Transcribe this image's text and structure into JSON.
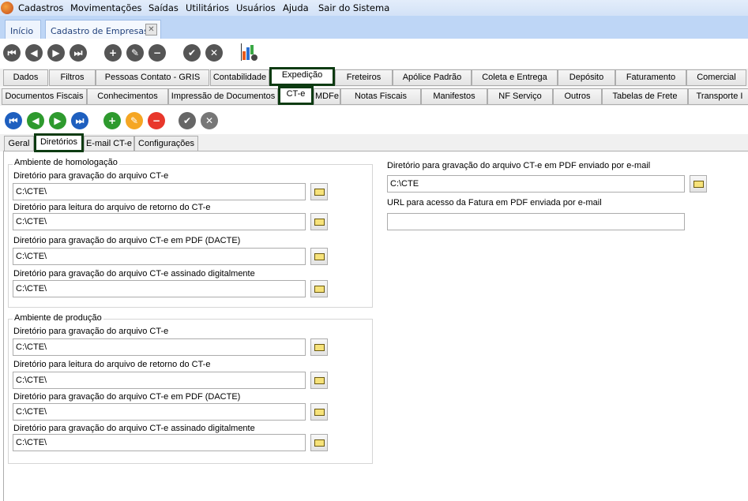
{
  "menu": [
    "Cadastros",
    "Movimentações",
    "Saídas",
    "Utilitários",
    "Usuários",
    "Ajuda",
    "Sair do Sistema"
  ],
  "doc_tabs": [
    "Início",
    "Cadastro de Empresas"
  ],
  "tabs_row1": [
    "Dados",
    "Filtros",
    "Pessoas Contato - GRIS",
    "Contabilidade",
    "Expedição",
    "Freteiros",
    "Apólice Padrão",
    "Coleta e Entrega",
    "Depósito",
    "Faturamento",
    "Comercial"
  ],
  "tabs_row2": [
    "Documentos Fiscais",
    "Conhecimentos",
    "Impressão de Documentos",
    "CT-e",
    "MDFe",
    "Notas Fiscais",
    "Manifestos",
    "NF Serviço",
    "Outros",
    "Tabelas de Frete",
    "Transporte I"
  ],
  "sub_tabs": [
    "Geral",
    "Diretórios",
    "E-mail CT-e",
    "Configurações"
  ],
  "homologacao": {
    "title": "Ambiente de homologação",
    "fields": [
      {
        "label": "Diretório para gravação do arquivo CT-e",
        "value": "C:\\CTE\\"
      },
      {
        "label": "Diretório para leitura do arquivo de retorno do CT-e",
        "value": "C:\\CTE\\"
      },
      {
        "label": "Diretório para gravação do arquivo CT-e em PDF (DACTE)",
        "value": "C:\\CTE\\"
      },
      {
        "label": "Diretório para gravação do arquivo CT-e assinado digitalmente",
        "value": "C:\\CTE\\"
      }
    ]
  },
  "producao": {
    "title": "Ambiente de produção",
    "fields": [
      {
        "label": "Diretório para gravação do arquivo CT-e",
        "value": "C:\\CTE\\"
      },
      {
        "label": "Diretório para leitura do arquivo de retorno do CT-e",
        "value": "C:\\CTE\\"
      },
      {
        "label": "Diretório para gravação do arquivo CT-e em PDF (DACTE)",
        "value": "C:\\CTE\\"
      },
      {
        "label": "Diretório para gravação do arquivo CT-e assinado digitalmente",
        "value": "C:\\CTE\\"
      }
    ]
  },
  "right": {
    "pdf_label": "Diretório para gravação do arquivo CT-e em PDF enviado por e-mail",
    "pdf_value": "C:\\CTE",
    "url_label": "URL para acesso da Fatura em PDF enviada por e-mail",
    "url_value": ""
  }
}
